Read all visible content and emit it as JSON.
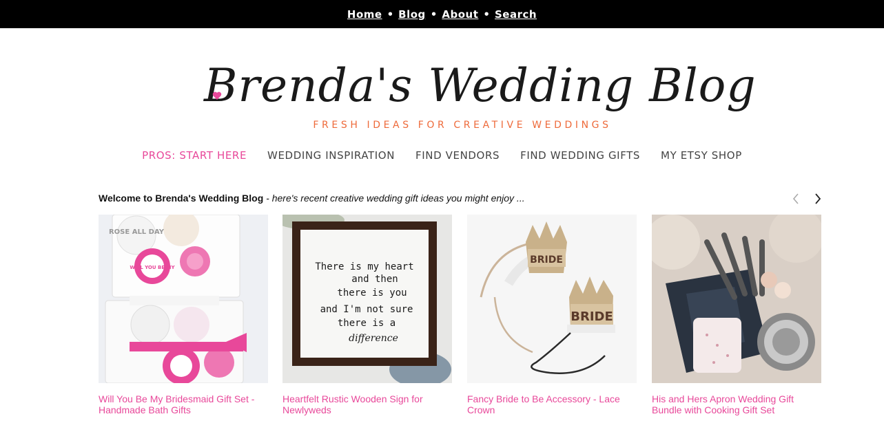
{
  "topnav": {
    "items": [
      "Home",
      "Blog",
      "About",
      "Search"
    ],
    "separator": "•"
  },
  "logo": {
    "title": "Brenda's Wedding Blog",
    "tagline": "FRESH IDEAS FOR CREATIVE WEDDINGS"
  },
  "mainnav": {
    "items": [
      "PROS: START HERE",
      "WEDDING INSPIRATION",
      "FIND VENDORS",
      "FIND WEDDING GIFTS",
      "MY ETSY SHOP"
    ]
  },
  "welcome": {
    "bold": "Welcome to Brenda's Wedding Blog",
    "rest": " - here's recent creative wedding gift ideas you might enjoy ..."
  },
  "cards": [
    {
      "title": "Will You Be My Bridesmaid Gift Set - Handmade Bath Gifts",
      "img_text": [
        "ROSE ALL DAY",
        "WILL YOU BE MY"
      ]
    },
    {
      "title": "Heartfelt Rustic Wooden Sign for Newlyweds",
      "img_text": [
        "There is my heart",
        "and then",
        "there is you",
        "and I'm not sure",
        "there is a",
        "difference"
      ]
    },
    {
      "title": "Fancy Bride to Be Accessory - Lace Crown",
      "img_text": [
        "BRIDE",
        "BRIDE"
      ]
    },
    {
      "title": "His and Hers Apron Wedding Gift Bundle with Cooking Gift Set",
      "img_text": []
    }
  ],
  "colors": {
    "accent": "#e8489a",
    "tagline": "#ee6a3a",
    "topbar": "#000000"
  }
}
